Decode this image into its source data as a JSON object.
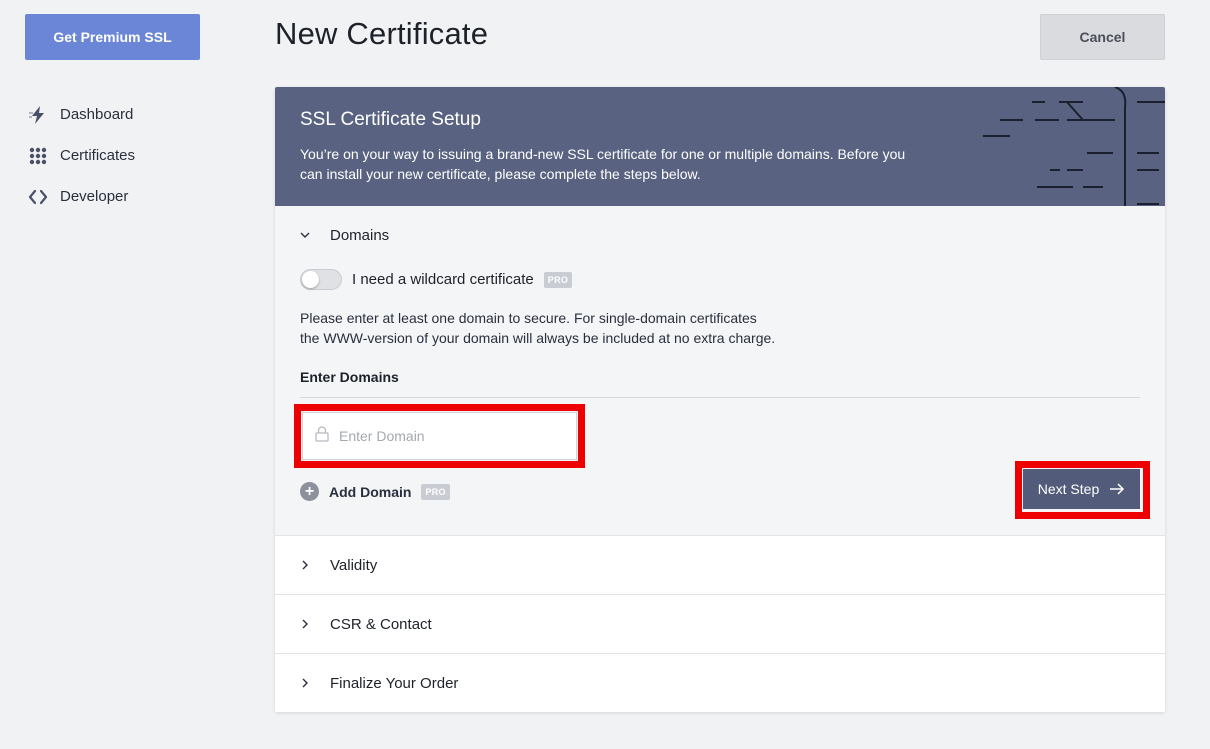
{
  "sidebar": {
    "premium_button": "Get Premium SSL",
    "items": [
      {
        "label": "Dashboard",
        "icon": "lightning-icon"
      },
      {
        "label": "Certificates",
        "icon": "grid-icon"
      },
      {
        "label": "Developer",
        "icon": "code-icon"
      }
    ]
  },
  "header": {
    "title": "New Certificate",
    "cancel_label": "Cancel"
  },
  "card": {
    "title": "SSL Certificate Setup",
    "description": "You’re on your way to issuing a brand-new SSL certificate for one or multiple domains. Before you can install your new certificate, please complete the steps below."
  },
  "domains_section": {
    "title": "Domains",
    "wildcard_label": "I need a wildcard certificate",
    "wildcard_enabled": false,
    "pro_badge": "PRO",
    "help_text_line1": "Please enter at least one domain to secure. For single-domain certificates",
    "help_text_line2": "the WWW-version of your domain will always be included at no extra charge.",
    "enter_domains_label": "Enter Domains",
    "domain_input_placeholder": "Enter Domain",
    "domain_input_value": "",
    "add_domain_label": "Add Domain",
    "next_step_label": "Next Step"
  },
  "collapsed_sections": [
    {
      "title": "Validity"
    },
    {
      "title": "CSR & Contact"
    },
    {
      "title": "Finalize Your Order"
    }
  ],
  "colors": {
    "primary": "#6b86d6",
    "header_bg": "#596381",
    "button_dark": "#525c7a",
    "highlight": "#ee0000"
  }
}
